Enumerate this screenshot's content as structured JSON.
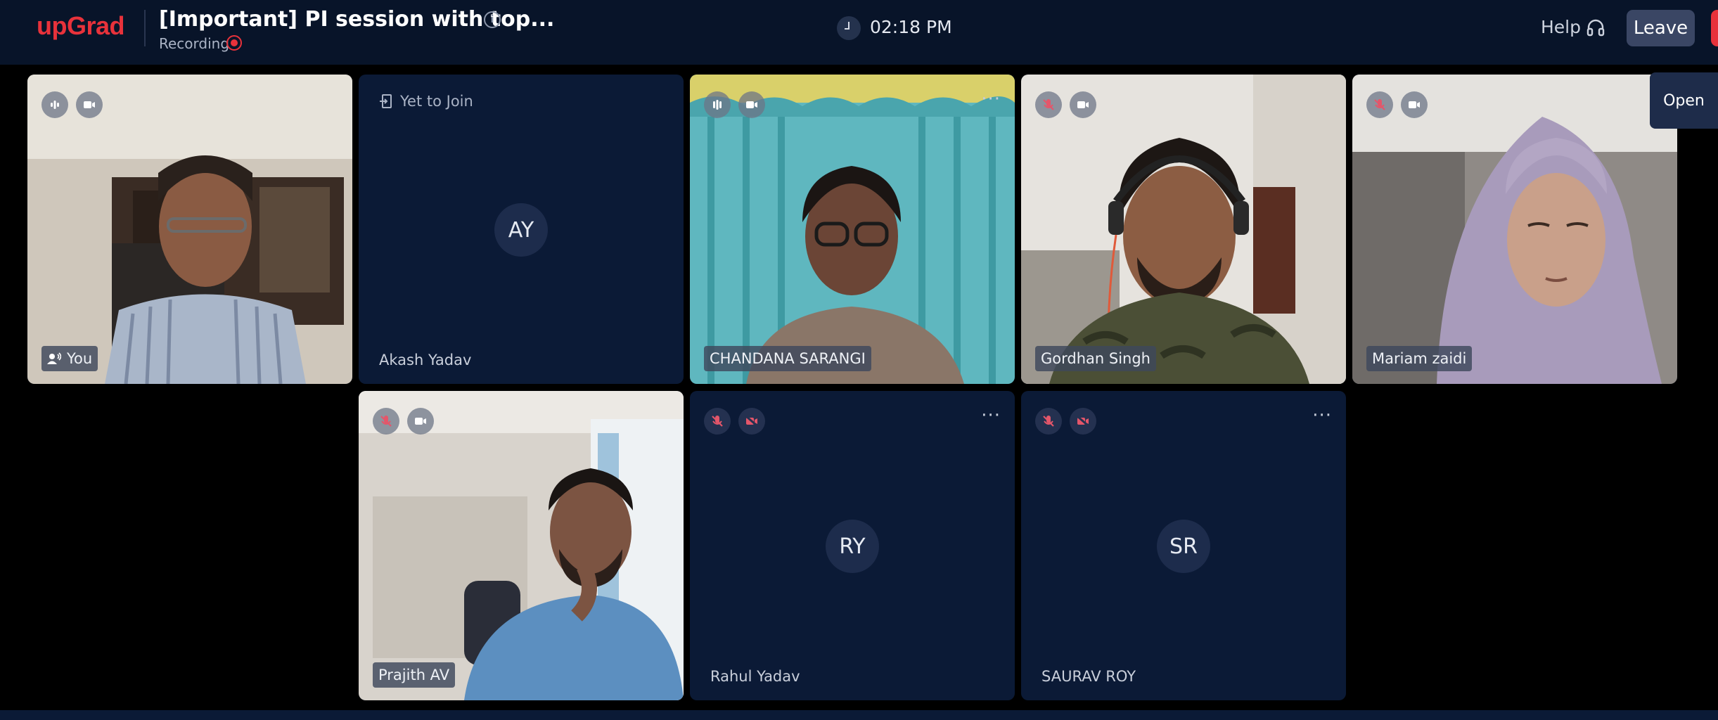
{
  "header": {
    "logo": "upGrad",
    "title": "[Important] PI session with top...",
    "recording_label": "Recording",
    "time": "02:18 PM",
    "help_label": "Help",
    "leave_label": "Leave"
  },
  "sidebar_toggle": {
    "label": "Open"
  },
  "participants": [
    {
      "name": "You",
      "video": true,
      "speaking": true
    },
    {
      "name": "Akash Yadav",
      "status": "Yet to Join",
      "initials": "AY",
      "video": false
    },
    {
      "name": "CHANDANA SARANGI",
      "video": true,
      "speaking": true
    },
    {
      "name": "Gordhan Singh",
      "video": true,
      "muted": true
    },
    {
      "name": "Mariam zaidi",
      "video": true,
      "muted": true
    },
    {
      "name": "Prajith AV",
      "video": true,
      "muted": true
    },
    {
      "name": "Rahul Yadav",
      "initials": "RY",
      "video": false,
      "muted": true
    },
    {
      "name": "SAURAV ROY",
      "initials": "SR",
      "video": false,
      "muted": true
    }
  ],
  "colors": {
    "brand": "#e8323b",
    "header_bg": "#081429",
    "tile_bg": "#0b1a36",
    "leave_bg": "#3a4664"
  }
}
